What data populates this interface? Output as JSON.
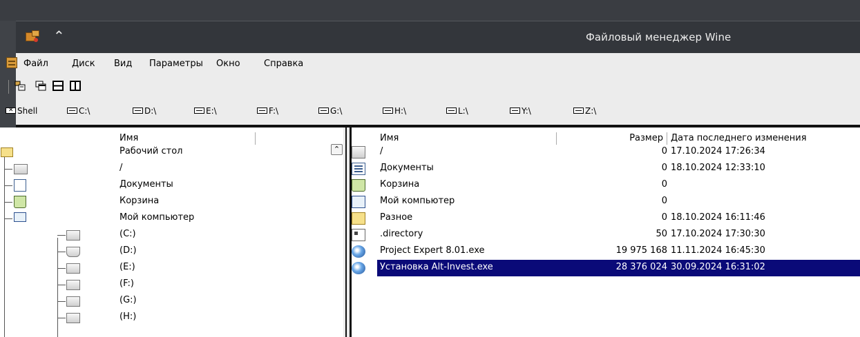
{
  "window": {
    "title": "Файловый менеджер Wine"
  },
  "menu": {
    "items": [
      {
        "label": "Файл"
      },
      {
        "label": "Диск"
      },
      {
        "label": "Вид"
      },
      {
        "label": "Параметры"
      },
      {
        "label": "Окно"
      },
      {
        "label": "Справка"
      }
    ]
  },
  "toolbar": {
    "icons": [
      "connect-drive-icon",
      "cascade-windows-icon",
      "tile-horizontal-icon",
      "tile-vertical-icon"
    ]
  },
  "drives": [
    {
      "label": "Shell",
      "icon": "shell-icon"
    },
    {
      "label": "C:\\",
      "icon": "drive-icon"
    },
    {
      "label": "D:\\",
      "icon": "cdrom-icon"
    },
    {
      "label": "E:\\",
      "icon": "drive-icon"
    },
    {
      "label": "F:\\",
      "icon": "drive-icon"
    },
    {
      "label": "G:\\",
      "icon": "drive-icon"
    },
    {
      "label": "H:\\",
      "icon": "drive-icon"
    },
    {
      "label": "L:\\",
      "icon": "drive-icon"
    },
    {
      "label": "Y:\\",
      "icon": "drive-icon"
    },
    {
      "label": "Z:\\",
      "icon": "drive-icon"
    }
  ],
  "tree": {
    "header": "Имя",
    "items": [
      {
        "label": "Рабочий стол",
        "icon": "folder-icon"
      },
      {
        "label": "/",
        "icon": "drive-icon"
      },
      {
        "label": "Документы",
        "icon": "documents-icon"
      },
      {
        "label": "Корзина",
        "icon": "trash-icon"
      },
      {
        "label": "Мой компьютер",
        "icon": "computer-icon"
      },
      {
        "label": " (C:)",
        "icon": "drive-icon"
      },
      {
        "label": " (D:)",
        "icon": "cdrom-icon"
      },
      {
        "label": " (E:)",
        "icon": "drive-icon"
      },
      {
        "label": " (F:)",
        "icon": "drive-icon"
      },
      {
        "label": " (G:)",
        "icon": "drive-icon"
      },
      {
        "label": " (H:)",
        "icon": "drive-icon"
      }
    ]
  },
  "list": {
    "columns": {
      "name": "Имя",
      "size": "Размер",
      "date": "Дата последнего изменения"
    },
    "rows": [
      {
        "name": "/",
        "size": "0",
        "date": "17.10.2024  17:26:34",
        "icon": "drive-icon"
      },
      {
        "name": "Документы",
        "size": "0",
        "date": "18.10.2024  12:33:10",
        "icon": "documents-icon"
      },
      {
        "name": "Корзина",
        "size": "0",
        "date": "",
        "icon": "trash-icon"
      },
      {
        "name": "Мой компьютер",
        "size": "0",
        "date": "",
        "icon": "computer-icon"
      },
      {
        "name": "Разное",
        "size": "0",
        "date": "18.10.2024  16:11:46",
        "icon": "folder-icon"
      },
      {
        "name": ".directory",
        "size": "50",
        "date": "17.10.2024  17:30:30",
        "icon": "file-icon"
      },
      {
        "name": "Project Expert 8.01.exe",
        "size": "19 975 168",
        "date": "11.11.2024  16:45:30",
        "icon": "exe-icon"
      },
      {
        "name": "Установка Alt-Invest.exe",
        "size": "28 376 024",
        "date": "30.09.2024  16:31:02",
        "icon": "exe-icon",
        "selected": true
      }
    ]
  },
  "colors": {
    "selection": "#0a0a78",
    "titlebar": "#33363b",
    "window_bg": "#ececec"
  }
}
